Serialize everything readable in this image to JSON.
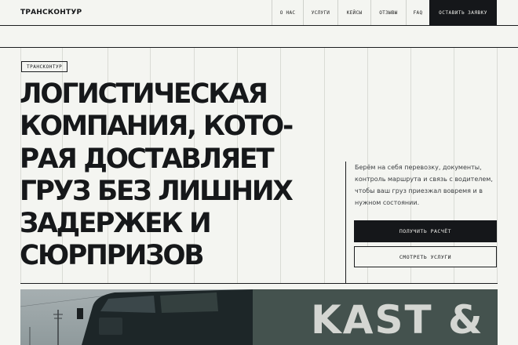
{
  "header": {
    "logo": "ТРАНСКОНТУР",
    "nav": [
      "О НАС",
      "УСЛУГИ",
      "КЕЙСЫ",
      "ОТЗЫВЫ",
      "FAQ"
    ],
    "cta": "ОСТАВИТЬ ЗАЯВКУ"
  },
  "hero": {
    "tag": "ТРАНСКОНТУР",
    "headline_lines": [
      "ЛОГИСТИЧЕСКАЯ",
      "КОМПАНИЯ, КОТО-",
      "РАЯ ДОСТАВЛЯЕТ",
      "ГРУЗ БЕЗ ЛИШНИХ",
      "ЗАДЕРЖЕК И",
      "СЮРПРИЗОВ"
    ],
    "description": "Берём на себя перевозку, документы, контроль маршрута и связь с водителем, чтобы ваш груз приезжал вовремя и в нужном состоянии.",
    "primary_button": "ПОЛУЧИТЬ РАСЧЁТ",
    "secondary_button": "СМОТРЕТЬ УСЛУГИ"
  },
  "photo": {
    "trailer_text": "KAST & S"
  }
}
